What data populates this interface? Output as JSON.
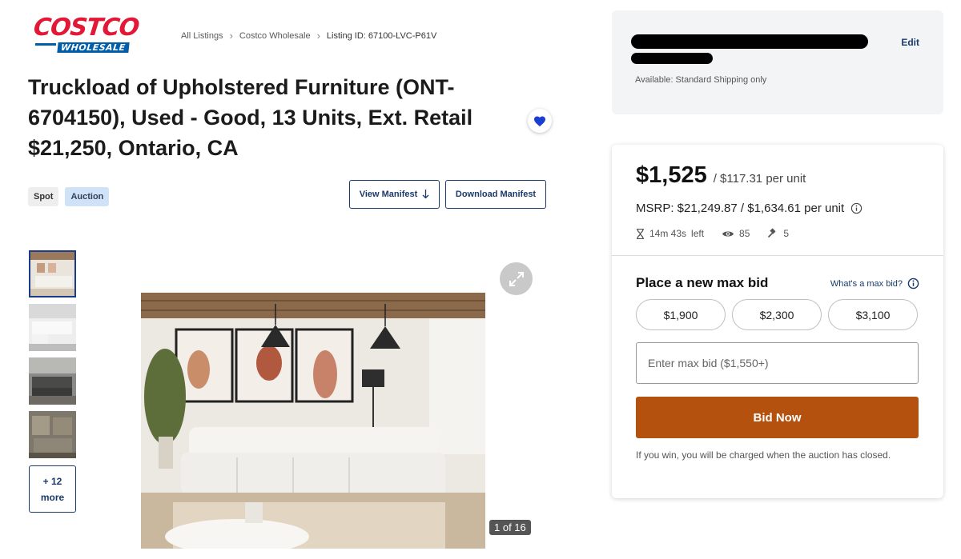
{
  "logo": {
    "top": "COSTCO",
    "bottom": "WHOLESALE"
  },
  "breadcrumb": {
    "items": [
      "All Listings",
      "Costco Wholesale"
    ],
    "current": "Listing ID: 67100-LVC-P61V"
  },
  "title": "Truckload of Upholstered Furniture (ONT-6704150), Used - Good, 13 Units, Ext. Retail $21,250, Ontario, CA",
  "favorite": {
    "icon": "heart-icon",
    "active": true
  },
  "tags": [
    "Spot",
    "Auction"
  ],
  "actions": {
    "view_manifest": "View Manifest",
    "download_manifest": "Download Manifest"
  },
  "gallery": {
    "more_count": "+ 12",
    "more_label": "more",
    "counter": "1 of 16"
  },
  "shipping": {
    "edit": "Edit",
    "note": "Available: Standard Shipping only"
  },
  "bid": {
    "price": "$1,525",
    "per_unit": "/ $117.31 per unit",
    "msrp": "MSRP: $21,249.87 / $1,634.61 per unit",
    "time_left": "14m 43s",
    "left_label": "left",
    "views": "85",
    "bids": "5",
    "place_title": "Place a new max bid",
    "whats_max": "What's a max bid?",
    "quick_bids": [
      "$1,900",
      "$2,300",
      "$3,100"
    ],
    "input_placeholder": "Enter max bid ($1,550+)",
    "button": "Bid Now",
    "note": "If you win, you will be charged when the auction has closed."
  },
  "colors": {
    "bid_button": "#b5510f",
    "brand_red": "#e31837",
    "brand_blue": "#005daa",
    "link_navy": "#1a3a6b"
  }
}
